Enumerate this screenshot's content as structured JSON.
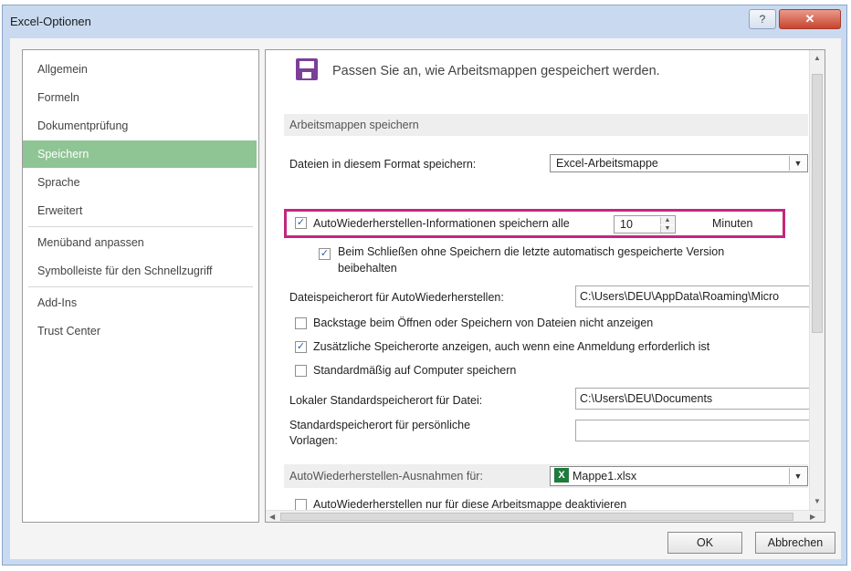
{
  "window": {
    "title": "Excel-Optionen",
    "help_glyph": "?",
    "close_glyph": "✕"
  },
  "sidebar": {
    "items": [
      {
        "label": "Allgemein",
        "selected": false
      },
      {
        "label": "Formeln",
        "selected": false
      },
      {
        "label": "Dokumentprüfung",
        "selected": false
      },
      {
        "label": "Speichern",
        "selected": true
      },
      {
        "label": "Sprache",
        "selected": false
      },
      {
        "label": "Erweitert",
        "selected": false
      },
      {
        "label": "Menüband anpassen",
        "selected": false
      },
      {
        "label": "Symbolleiste für den Schnellzugriff",
        "selected": false
      },
      {
        "label": "Add-Ins",
        "selected": false
      },
      {
        "label": "Trust Center",
        "selected": false
      }
    ]
  },
  "main": {
    "header": "Passen Sie an, wie Arbeitsmappen gespeichert werden.",
    "section_save": "Arbeitsmappen speichern",
    "format_label": "Dateien in diesem Format speichern:",
    "format_value": "Excel-Arbeitsmappe",
    "autorecover_label": "AutoWiederherstellen-Informationen speichern alle",
    "autorecover_checked": true,
    "autorecover_minutes": "10",
    "minutes_label": "Minuten",
    "keep_version_label_line1": "Beim Schließen ohne Speichern die letzte automatisch gespeicherte Version",
    "keep_version_label_line2": "beibehalten",
    "keep_version_checked": true,
    "autorecover_location_label": "Dateispeicherort für AutoWiederherstellen:",
    "autorecover_location_value": "C:\\Users\\DEU\\AppData\\Roaming\\Micro",
    "backstage_label": "Backstage beim Öffnen oder Speichern von Dateien nicht anzeigen",
    "backstage_checked": false,
    "additional_locations_label": "Zusätzliche Speicherorte anzeigen, auch wenn eine Anmeldung erforderlich ist",
    "additional_locations_checked": true,
    "save_to_computer_label": "Standardmäßig auf Computer speichern",
    "save_to_computer_checked": false,
    "local_location_label": "Lokaler Standardspeicherort für Datei:",
    "local_location_value": "C:\\Users\\DEU\\Documents",
    "templates_label_line1": "Standardspeicherort für persönliche",
    "templates_label_line2": "Vorlagen:",
    "templates_value": "",
    "section_exceptions": "AutoWiederherstellen-Ausnahmen für:",
    "exceptions_workbook": "Mappe1.xlsx",
    "exceptions_icon_letter": "X",
    "disable_label": "AutoWiederherstellen nur für diese Arbeitsmappe deaktivieren",
    "disable_checked": false
  },
  "check_glyph": "✓",
  "footer": {
    "ok_label": "OK",
    "cancel_label": "Abbrechen"
  },
  "colors": {
    "selected_nav": "#8fc494",
    "highlight_border": "#c2277e",
    "save_icon": "#7b3f99"
  }
}
